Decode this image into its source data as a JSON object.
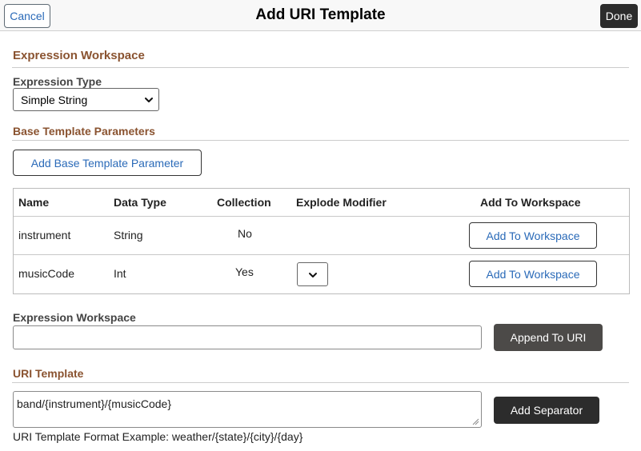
{
  "header": {
    "title": "Add URI Template",
    "cancel_label": "Cancel",
    "done_label": "Done"
  },
  "expression_workspace_section": {
    "title": "Expression Workspace",
    "expression_type_label": "Expression Type",
    "expression_type_value": "Simple String"
  },
  "base_params_section": {
    "title": "Base Template Parameters",
    "add_button_label": "Add Base Template Parameter",
    "table": {
      "headers": [
        "Name",
        "Data Type",
        "Collection",
        "Explode Modifier",
        "Add To Workspace"
      ],
      "rows": [
        {
          "name": "instrument",
          "data_type": "String",
          "collection": "No",
          "explode_modifier": "",
          "action_label": "Add To Workspace"
        },
        {
          "name": "musicCode",
          "data_type": "Int",
          "collection": "Yes",
          "explode_modifier": "",
          "action_label": "Add To Workspace"
        }
      ]
    }
  },
  "workspace_input": {
    "label": "Expression Workspace",
    "value": "",
    "append_label": "Append To URI"
  },
  "uri_template": {
    "title": "URI Template",
    "value": "band/{instrument}/{musicCode}",
    "add_separator_label": "Add Separator",
    "helper_text": "URI Template Format Example: weather/{state}/{city}/{day}"
  },
  "colors": {
    "section_title": "#8a5330",
    "link_text": "#2a6ab8",
    "dark_button": "#2c2c2c",
    "append_button": "#4c4a48"
  },
  "icons": {
    "select_arrow": "chevron-down-icon",
    "resize": "resize-grip-icon"
  }
}
